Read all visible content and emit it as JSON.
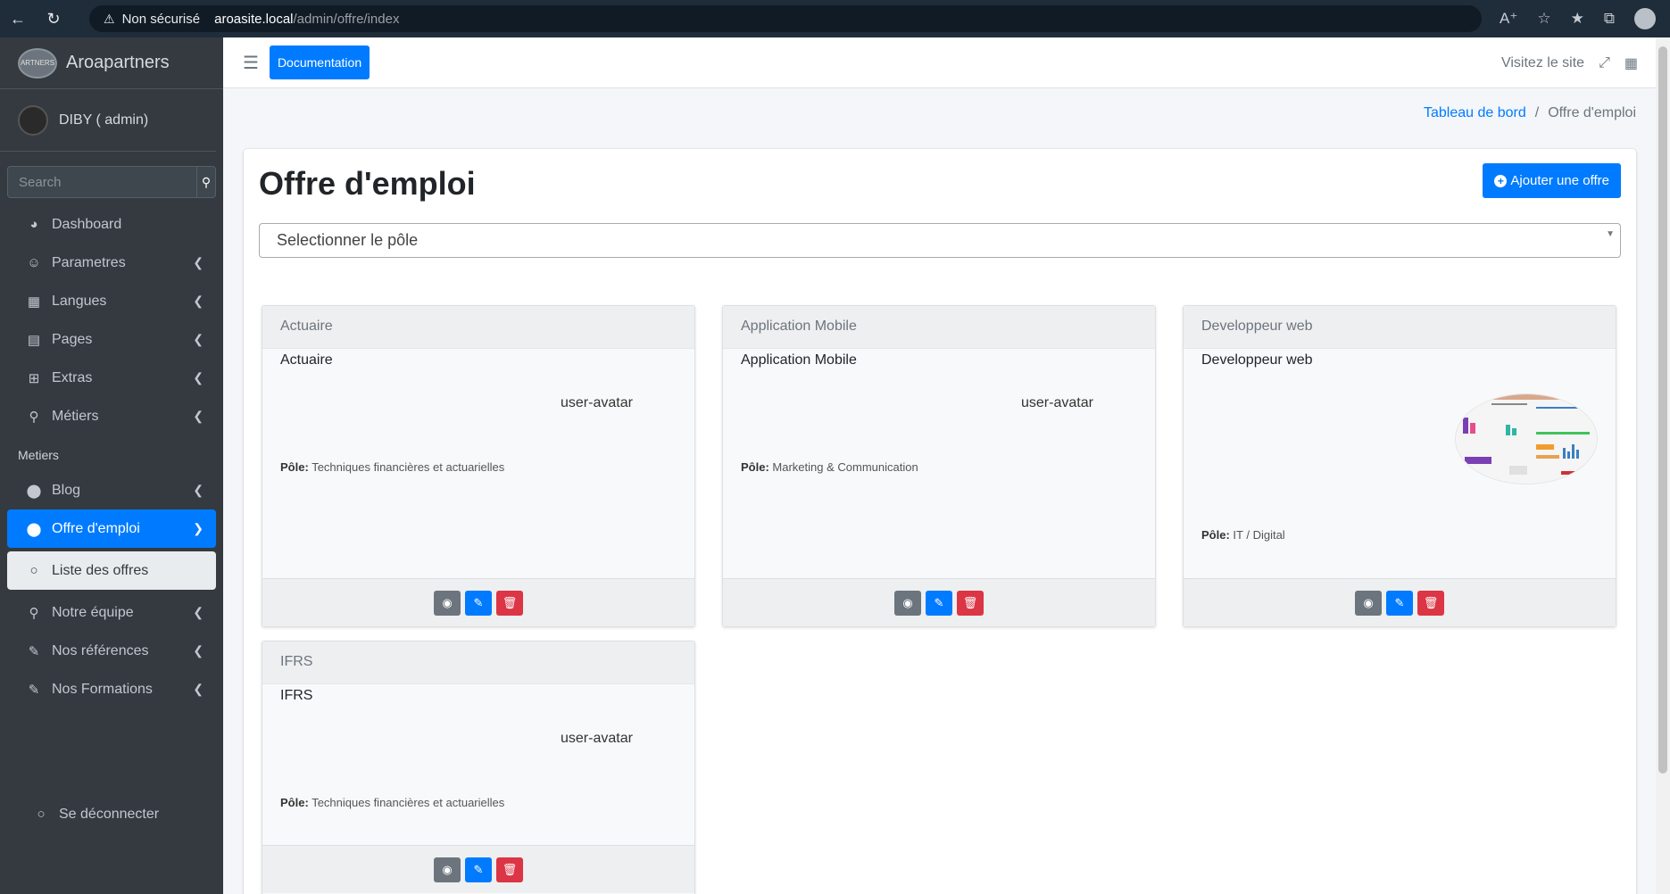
{
  "browser": {
    "security_label": "Non sécurisé",
    "host": "aroasite.local",
    "path": "/admin/offre/index"
  },
  "sidebar": {
    "brand": "Aroapartners",
    "brand_logo_text": "ARTNERS",
    "user": "DIBY ( admin)",
    "search_placeholder": "Search",
    "items": [
      {
        "label": "Dashboard"
      },
      {
        "label": "Parametres"
      },
      {
        "label": "Langues"
      },
      {
        "label": "Pages"
      },
      {
        "label": "Extras"
      },
      {
        "label": "Métiers"
      }
    ],
    "section_header": "Metiers",
    "items2": [
      {
        "label": "Blog"
      },
      {
        "label": "Offre d'emploi"
      },
      {
        "label": "Liste des offres"
      },
      {
        "label": "Notre équipe"
      },
      {
        "label": "Nos références"
      },
      {
        "label": "Nos Formations"
      }
    ],
    "logout": "Se déconnecter"
  },
  "topnav": {
    "doc_button": "Documentation",
    "visit_site": "Visitez le site"
  },
  "breadcrumb": {
    "home": "Tableau de bord",
    "current": "Offre d'emploi"
  },
  "main": {
    "title": "Offre d'emploi",
    "add_button": "Ajouter une offre",
    "select_placeholder": "Selectionner le pôle",
    "pole_label": "Pôle:",
    "offers": [
      {
        "header": "Actuaire",
        "title": "Actuaire",
        "img_alt": "user-avatar",
        "pole": "Techniques financières et actuarielles"
      },
      {
        "header": "Application Mobile",
        "title": "Application Mobile",
        "img_alt": "user-avatar",
        "pole": "Marketing & Communication"
      },
      {
        "header": "Developpeur web",
        "title": "Developpeur web",
        "img_alt": "",
        "pole": "IT / Digital"
      },
      {
        "header": "IFRS",
        "title": "IFRS",
        "img_alt": "user-avatar",
        "pole": "Techniques financières et actuarielles"
      }
    ]
  },
  "colors": {
    "primary": "#007bff",
    "danger": "#dc3545",
    "secondary": "#6c757d",
    "sidebar_bg": "#343a40"
  }
}
